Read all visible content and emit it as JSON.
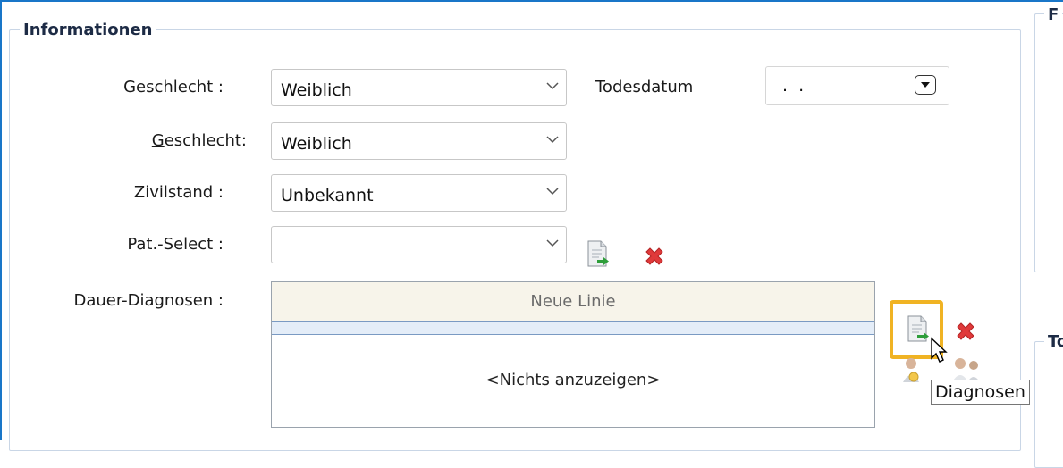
{
  "group": {
    "title": "Informationen"
  },
  "right_panels": {
    "top_title": "F",
    "bottom_title": "To"
  },
  "fields": {
    "geschlecht1": {
      "label": "Geschlecht :",
      "value": "Weiblich"
    },
    "todesdatum": {
      "label": "Todesdatum",
      "value": ". ."
    },
    "geschlecht2": {
      "label_prefix": "G",
      "label_rest": "eschlecht:",
      "value": "Weiblich"
    },
    "zivilstand": {
      "label": "Zivilstand :",
      "value": "Unbekannt"
    },
    "patselect": {
      "label": "Pat.-Select :",
      "value": ""
    },
    "dauer": {
      "label": "Dauer-Diagnosen :"
    }
  },
  "grid": {
    "new_line": "Neue Linie",
    "empty_text": "<Nichts anzuzeigen>"
  },
  "tooltip": "Diagnosen",
  "icons": {
    "add": "add-document-icon",
    "delete": "delete-icon",
    "users": "users-icon"
  },
  "colors": {
    "accent": "#1976c8",
    "highlight": "#f0b323",
    "delete": "#e0393a"
  }
}
